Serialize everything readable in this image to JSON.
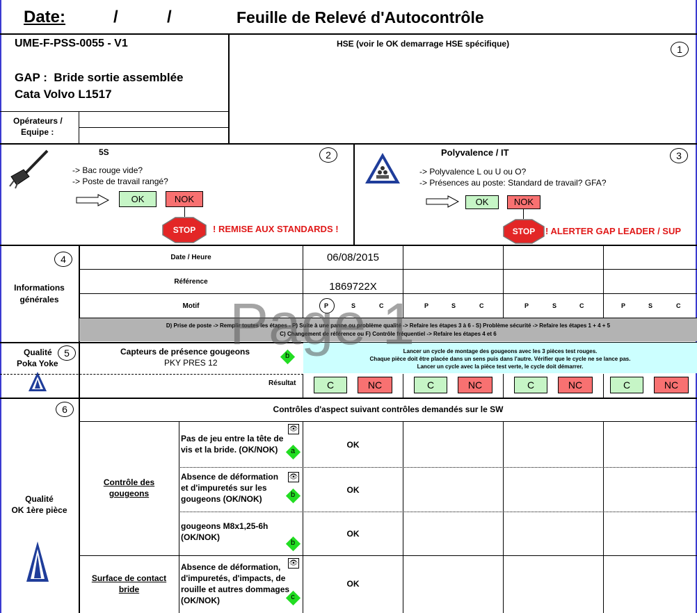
{
  "header": {
    "date_label": "Date:",
    "date_sep1": "/",
    "date_sep2": "/",
    "title": "Feuille de Relevé d'Autocontrôle"
  },
  "doc": {
    "ref": "UME-F-PSS-0055 - V1",
    "gap_line": "GAP :  Bride sortie assemblée",
    "cata_line": "Cata Volvo L1517",
    "operators_label_1": "Opérateurs /",
    "operators_label_2": "Equipe :"
  },
  "hse": {
    "text": "HSE (voir le OK demarrage HSE spécifique)",
    "num": "1"
  },
  "section_5s": {
    "title": "5S",
    "num": "2",
    "line1": "-> Bac rouge vide?",
    "line2": "-> Poste de travail rangé?",
    "ok": "OK",
    "nok": "NOK",
    "stop": "STOP",
    "warning": "! REMISE AUX STANDARDS !"
  },
  "section_poly": {
    "title": "Polyvalence / IT",
    "num": "3",
    "line1": "-> Polyvalence L ou U ou O?",
    "line2": "-> Présences au poste: Standard de travail? GFA?",
    "ok": "OK",
    "nok": "NOK",
    "stop": "STOP",
    "warning": "! ALERTER GAP LEADER / SUP"
  },
  "info": {
    "num": "4",
    "label_1": "Informations",
    "label_2": "générales",
    "date_heure": "Date / Heure",
    "reference": "Référence",
    "motif": "Motif",
    "date_value": "06/08/2015",
    "reference_value": "1869722X",
    "p": "P",
    "s": "S",
    "c": "C",
    "legend_1": "D) Prise de poste -> Remplir toutes les étapes  -  P) Suite à une panne ou problème qualité -> Refaire les étapes 3 à 6  -  S) Problème sécurité -> Refaire les étapes 1 + 4 + 5",
    "legend_2": "C) Changement de référence ou  F) Contrôle fréquentiel -> Refaire les étapes 4 et 6"
  },
  "watermark": "Page 1",
  "pokayoke": {
    "num": "5",
    "label_1": "Qualité",
    "label_2": "Poka Yoke",
    "capteur_1": "Capteurs de présence gougeons",
    "capteur_2": "PKY PRES 12",
    "badge": "b",
    "instr_1": "Lancer un cycle de montage des gougeons avec les 3 pièces test rouges.",
    "instr_2": "Chaque pièce doit être placée dans un sens puis dans l'autre. Vérifier que le cycle ne se lance pas.",
    "instr_3": "Lancer un cycle avec la pièce test verte, le cycle doit démarrer.",
    "resultat": "Résultat",
    "c": "C",
    "nc": "NC"
  },
  "aspect": {
    "num": "6",
    "header": "Contrôles d'aspect suivant contrôles demandés sur le SW",
    "label_1": "Qualité",
    "label_2": "OK 1ère pièce",
    "group1_1": "Contrôle des",
    "group1_2": "gougeons",
    "group2_1": "Surface de contact",
    "group2_2": "bride",
    "items": [
      {
        "l1": "Pas de jeu entre la tête de",
        "l2": "vis et la bride. (OK/NOK)",
        "l3": "",
        "l4": "",
        "badge": "a",
        "value": "OK"
      },
      {
        "l1": "Absence de déformation",
        "l2": "et d'impuretés sur les",
        "l3": "gougeons (OK/NOK)",
        "l4": "",
        "badge": "b",
        "value": "OK"
      },
      {
        "l1": "gougeons M8x1,25-6h",
        "l2": "(OK/NOK)",
        "l3": "",
        "l4": "",
        "badge": "b",
        "value": "OK"
      },
      {
        "l1": "Absence de déformation,",
        "l2": "d'impuretés, d'impacts, de",
        "l3": "rouille et autres dommages",
        "l4": "(OK/NOK)",
        "badge": "c",
        "value": "OK"
      }
    ]
  },
  "icons": {
    "eye": "👁"
  },
  "colors": {
    "frame": "#3a3ad0",
    "ok_green": "#c6f5c6",
    "nok_red": "#f87171",
    "legend_bg": "#b3b3b3",
    "instr_bg": "#ccffff",
    "badge_green": "#22dd22",
    "stop_red": "#e32626",
    "warning_red": "#e01818"
  }
}
